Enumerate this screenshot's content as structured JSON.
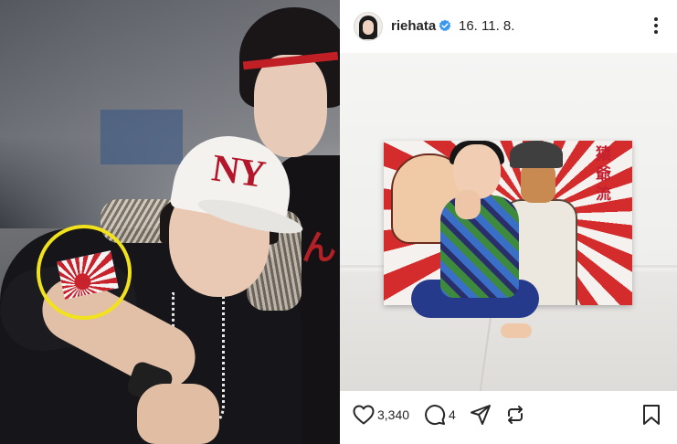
{
  "left_photo": {
    "cap_text": "NY"
  },
  "post": {
    "username": "riehata",
    "date": "16. 11. 8.",
    "icons": {
      "verified": "verified-badge-icon",
      "more": "more-options-icon",
      "like": "heart-icon",
      "comment": "comment-icon",
      "share": "share-icon",
      "repost": "repost-icon",
      "save": "bookmark-icon"
    },
    "likes": "3,340",
    "comments": "4"
  },
  "colors": {
    "verified": "#3897f0",
    "highlight": "#f2e21b",
    "text": "#262626"
  }
}
